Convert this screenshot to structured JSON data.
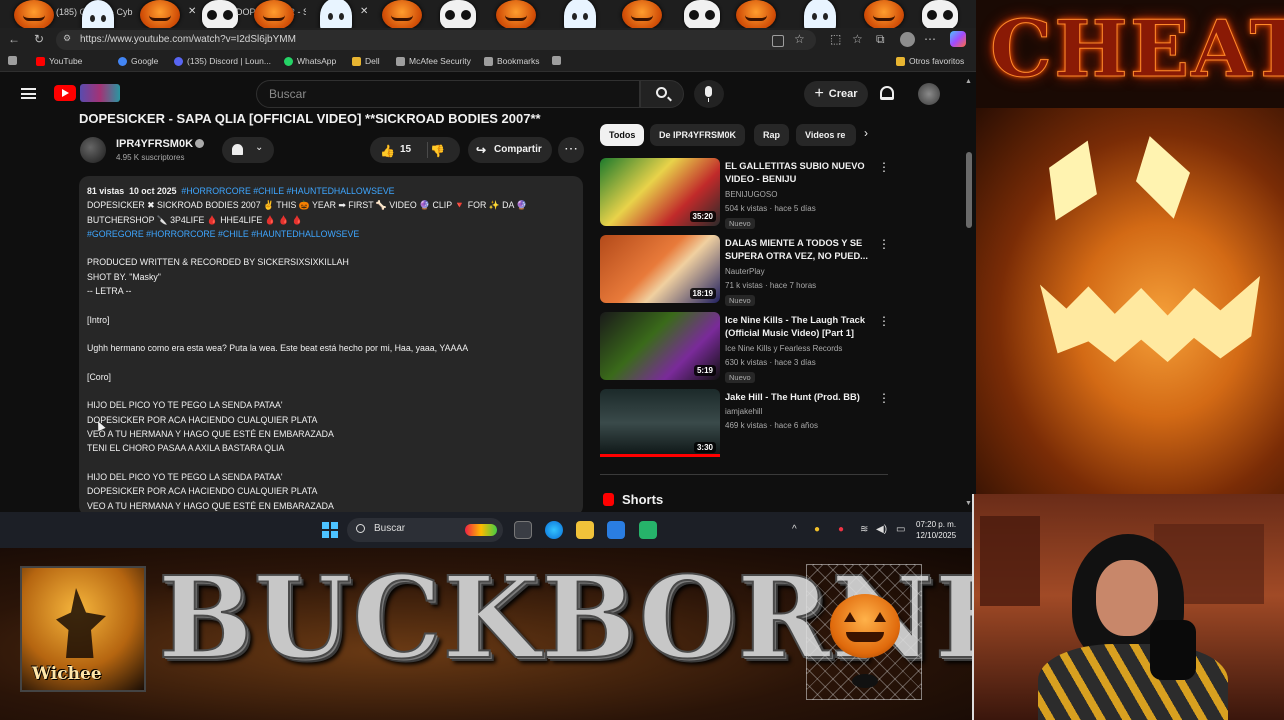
{
  "browser": {
    "tabs": [
      {
        "label": "(185) Ca...nd - Cyb"
      },
      {
        "label": "DOPESICKER - SAPA QLIA (OFFICIAL VIDEO)"
      }
    ],
    "url": "https://www.youtube.com/watch?v=I2dSl6jbYMM",
    "bookmarks": [
      {
        "label": "YouTube",
        "color": "#ff0000"
      },
      {
        "label": "Google",
        "color": "#4285f4"
      },
      {
        "label": "(135) Discord | Loun...",
        "color": "#5865f2"
      },
      {
        "label": "WhatsApp",
        "color": "#25d366"
      },
      {
        "label": "Dell",
        "color": "#e8b531"
      },
      {
        "label": "McAfee Security",
        "color": "#9e9e9e"
      },
      {
        "label": "Bookmarks",
        "color": "#9e9e9e"
      }
    ],
    "other_bookmarks": "Otros favoritos"
  },
  "youtube": {
    "search_placeholder": "Buscar",
    "create_label": "Crear",
    "video_title": "DOPESICKER - SAPA QLIA [OFFICIAL VIDEO] **SICKROAD BODIES 2007**",
    "channel": {
      "name": "IPR4YFRSM0K",
      "subscribers": "4.95 K suscriptores"
    },
    "likes": "15",
    "share_label": "Compartir",
    "description": {
      "views": "81 vistas",
      "date": "10 oct 2025",
      "hashtags_top": "#HORRORCORE #CHILE #HAUNTEDHALLOWSEVE",
      "lines": [
        "DOPESICKER ✖ SICKROAD BODIES 2007 ✌ THIS 🎃 YEAR ➡ FIRST 🦴 VIDEO 🔮 CLIP 🔻 FOR ✨ DA 🔮",
        "BUTCHERSHOP 🔪 3P4LIFE 🩸 HHE4LIFE 🩸 🩸 🩸"
      ],
      "hashtags_bottom": "#GOREGORE #HORRORCORE #CHILE #HAUNTEDHALLOWSEVE",
      "body": [
        "",
        "PRODUCED WRITTEN & RECORDED BY SICKERSIXSIXKILLAH",
        "SHOT BY. \"Masky\"",
        "-- LETRA --",
        "",
        "[Intro]",
        "",
        "Ughh hermano como era esta wea? Puta la wea. Este beat está hecho por mi, Haa, yaaa, YAAAA",
        "",
        "[Coro]",
        "",
        "HIJO DEL PICO YO TE PEGO LA SENDA PATAA'",
        "DOPESICKER POR ACA HACIENDO CUALQUIER PLATA",
        "VEO A TU HERMANA Y HAGO QUE ESTÉ EN EMBARAZADA",
        "TENI EL CHORO PASAA A AXILA BASTARA QLIA",
        "",
        "HIJO DEL PICO YO TE PEGO LA SENDA PATAA'",
        "DOPESICKER POR ACA HACIENDO CUALQUIER PLATA",
        "VEO A TU HERMANA Y HAGO QUE ESTÉ EN EMBARAZADA"
      ]
    },
    "chips": [
      "Todos",
      "De IPR4YFRSM0K",
      "Rap",
      "Videos re"
    ],
    "recommendations": [
      {
        "title": "EL GALLETITAS SUBIO NUEVO VIDEO - BENIJU",
        "channel": "BENIJUGOSO",
        "views": "504 k vistas · hace 5 días",
        "badge": "Nuevo",
        "duration": "35:20",
        "thumb": "linear-gradient(135deg,#1c7a2c,#e8d24a 40%,#c12a2a 70%,#2a2a2a)"
      },
      {
        "title": "DALAS MIENTE A TODOS Y SE SUPERA OTRA VEZ, NO PUED...",
        "channel": "NauterPlay",
        "views": "71 k vistas · hace 7 horas",
        "badge": "Nuevo",
        "duration": "18:19",
        "thumb": "linear-gradient(135deg,#b34a1a,#e87a3a 45%,#f0d0a0 60%,#202060)"
      },
      {
        "title": "Ice Nine Kills - The Laugh Track (Official Music Video) [Part 1]",
        "channel": "Ice Nine Kills y Fearless Records",
        "views": "630 k vistas · hace 3 días",
        "badge": "Nuevo",
        "duration": "5:19",
        "thumb": "linear-gradient(135deg,#1a1a1a,#3a6a1a 40%,#7a2a9a 70%,#111)"
      },
      {
        "title": "Jake Hill - The Hunt (Prod. BB)",
        "channel": "iamjakehill",
        "views": "469 k vistas · hace 6 años",
        "badge": "",
        "duration": "3:30",
        "thumb": "linear-gradient(180deg,#1c2a2a,#3a4a4a 50%,#0c1414)"
      }
    ],
    "shorts_label": "Shorts"
  },
  "taskbar": {
    "search_label": "Buscar",
    "time": "07:20 p. m.",
    "date": "12/10/2025"
  },
  "overlay": {
    "banner_title": "BUCKBORNE",
    "logo_text": "Wichee",
    "cheat_text": "CHEAT"
  }
}
